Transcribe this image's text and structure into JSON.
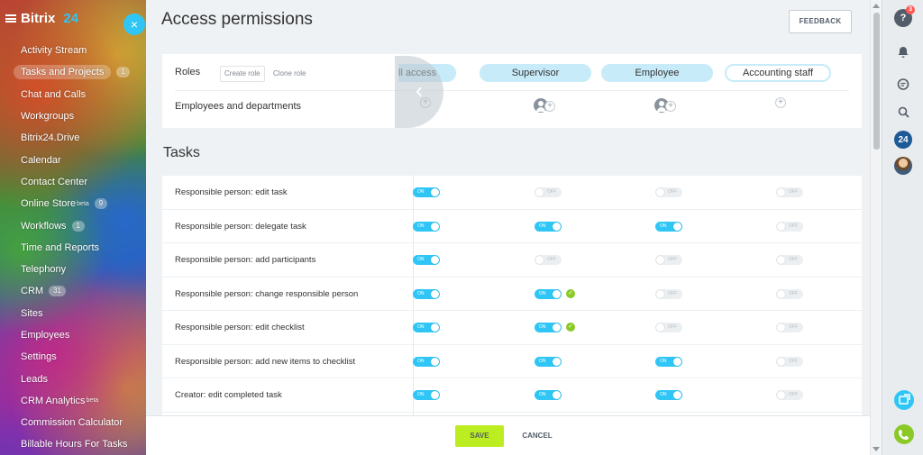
{
  "sidebar": {
    "brand_name": "Bitrix",
    "brand_number": "24",
    "items": [
      {
        "label": "Activity Stream",
        "sup": "",
        "count": ""
      },
      {
        "label": "Tasks and Projects",
        "sup": "",
        "count": "1",
        "active": true
      },
      {
        "label": "Chat and Calls",
        "sup": "",
        "count": ""
      },
      {
        "label": "Workgroups",
        "sup": "",
        "count": ""
      },
      {
        "label": "Bitrix24.Drive",
        "sup": "",
        "count": ""
      },
      {
        "label": "Calendar",
        "sup": "",
        "count": ""
      },
      {
        "label": "Contact Center",
        "sup": "",
        "count": ""
      },
      {
        "label": "Online Store",
        "sup": "beta",
        "count": "9"
      },
      {
        "label": "Workflows",
        "sup": "",
        "count": "1"
      },
      {
        "label": "Time and Reports",
        "sup": "",
        "count": ""
      },
      {
        "label": "Telephony",
        "sup": "",
        "count": ""
      },
      {
        "label": "CRM",
        "sup": "",
        "count": "31"
      },
      {
        "label": "Sites",
        "sup": "",
        "count": ""
      },
      {
        "label": "Employees",
        "sup": "",
        "count": ""
      },
      {
        "label": "Settings",
        "sup": "",
        "count": ""
      },
      {
        "label": "Leads",
        "sup": "",
        "count": ""
      },
      {
        "label": "CRM Analytics",
        "sup": "beta",
        "count": ""
      },
      {
        "label": "Commission Calculator",
        "sup": "",
        "count": ""
      },
      {
        "label": "Billable Hours For Tasks",
        "sup": "",
        "count": ""
      }
    ]
  },
  "close_button": "×",
  "page": {
    "title": "Access permissions",
    "feedback": "FEEDBACK"
  },
  "roles": {
    "label": "Roles",
    "create_role": "Create role",
    "clone_role": "Clone role",
    "employees_label": "Employees and departments",
    "columns": [
      "ll access",
      "Supervisor",
      "Employee",
      "Accounting staff"
    ],
    "scroll_arrow": "‹"
  },
  "tasks": {
    "section_title": "Tasks",
    "toggle_on_text": "ON",
    "toggle_off_text": "OFF",
    "rows": [
      {
        "label": "Responsible person: edit task",
        "values": [
          true,
          false,
          false,
          false
        ],
        "checks": [
          false,
          false,
          false,
          false
        ]
      },
      {
        "label": "Responsible person: delegate task",
        "values": [
          true,
          true,
          true,
          false
        ],
        "checks": [
          false,
          false,
          false,
          false
        ]
      },
      {
        "label": "Responsible person: add participants",
        "values": [
          true,
          false,
          false,
          false
        ],
        "checks": [
          false,
          false,
          false,
          false
        ]
      },
      {
        "label": "Responsible person: change responsible person",
        "values": [
          true,
          true,
          false,
          false
        ],
        "checks": [
          false,
          true,
          false,
          false
        ]
      },
      {
        "label": "Responsible person: edit checklist",
        "values": [
          true,
          true,
          false,
          false
        ],
        "checks": [
          false,
          true,
          false,
          false
        ]
      },
      {
        "label": "Responsible person: add new items to checklist",
        "values": [
          true,
          true,
          true,
          false
        ],
        "checks": [
          false,
          false,
          false,
          false
        ]
      },
      {
        "label": "Creator: edit completed task",
        "values": [
          true,
          true,
          true,
          false
        ],
        "checks": [
          false,
          false,
          false,
          false
        ]
      }
    ]
  },
  "footer": {
    "save": "SAVE",
    "cancel": "CANCEL"
  },
  "rightbar": {
    "help_badge": "3",
    "b24_label": "24"
  },
  "colors": {
    "accent": "#2fc6f6",
    "save_green": "#bbed21",
    "role_pill": "#c7ebf9"
  }
}
